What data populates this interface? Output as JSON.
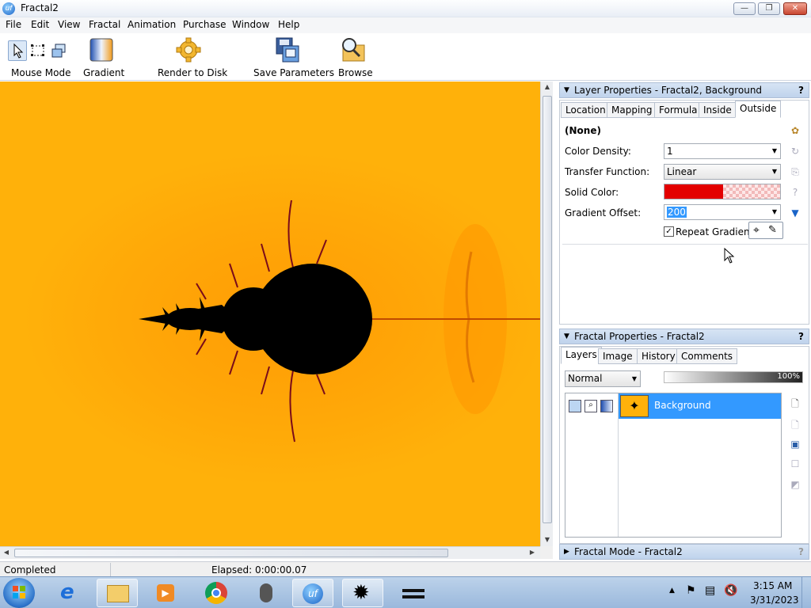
{
  "window": {
    "title": "Fractal2",
    "app_icon_text": "uf",
    "minimize": "—",
    "restore": "❐",
    "close": "✕"
  },
  "menu": [
    "File",
    "Edit",
    "View",
    "Fractal",
    "Animation",
    "Purchase",
    "Window",
    "Help"
  ],
  "toolbar": {
    "mouse_mode": "Mouse Mode",
    "gradient": "Gradient",
    "render_to_disk": "Render to Disk",
    "save_parameters": "Save Parameters",
    "browse": "Browse"
  },
  "layer_properties": {
    "title": "Layer Properties - Fractal2, Background",
    "help": "?",
    "tabs": [
      "Location",
      "Mapping",
      "Formula",
      "Inside",
      "Outside"
    ],
    "active_tab": "Outside",
    "algorithm": "(None)",
    "color_density_label": "Color Density:",
    "color_density_value": "1",
    "transfer_function_label": "Transfer Function:",
    "transfer_function_value": "Linear",
    "solid_color_label": "Solid Color:",
    "solid_color": "#e30000",
    "gradient_offset_label": "Gradient Offset:",
    "gradient_offset_value": "200",
    "repeat_gradient_label": "Repeat Gradient",
    "repeat_gradient_checked": true
  },
  "fractal_properties": {
    "title": "Fractal Properties - Fractal2",
    "help": "?",
    "tabs": [
      "Layers",
      "Image",
      "History",
      "Comments"
    ],
    "active_tab": "Layers",
    "blend_mode": "Normal",
    "opacity": "100%",
    "layers": [
      {
        "name": "Background",
        "selected": true
      }
    ]
  },
  "fractal_mode": {
    "title": "Fractal Mode - Fractal2",
    "help": "?"
  },
  "status": {
    "left": "Completed",
    "elapsed": "Elapsed: 0:00:00.07"
  },
  "taskbar": {
    "time": "3:15 AM",
    "date": "3/31/2023",
    "start_icon": "windows-start-icon"
  },
  "colors": {
    "canvas_bg": "#ffb10a",
    "selection": "#3399ff",
    "accent": "#1a64c8"
  }
}
